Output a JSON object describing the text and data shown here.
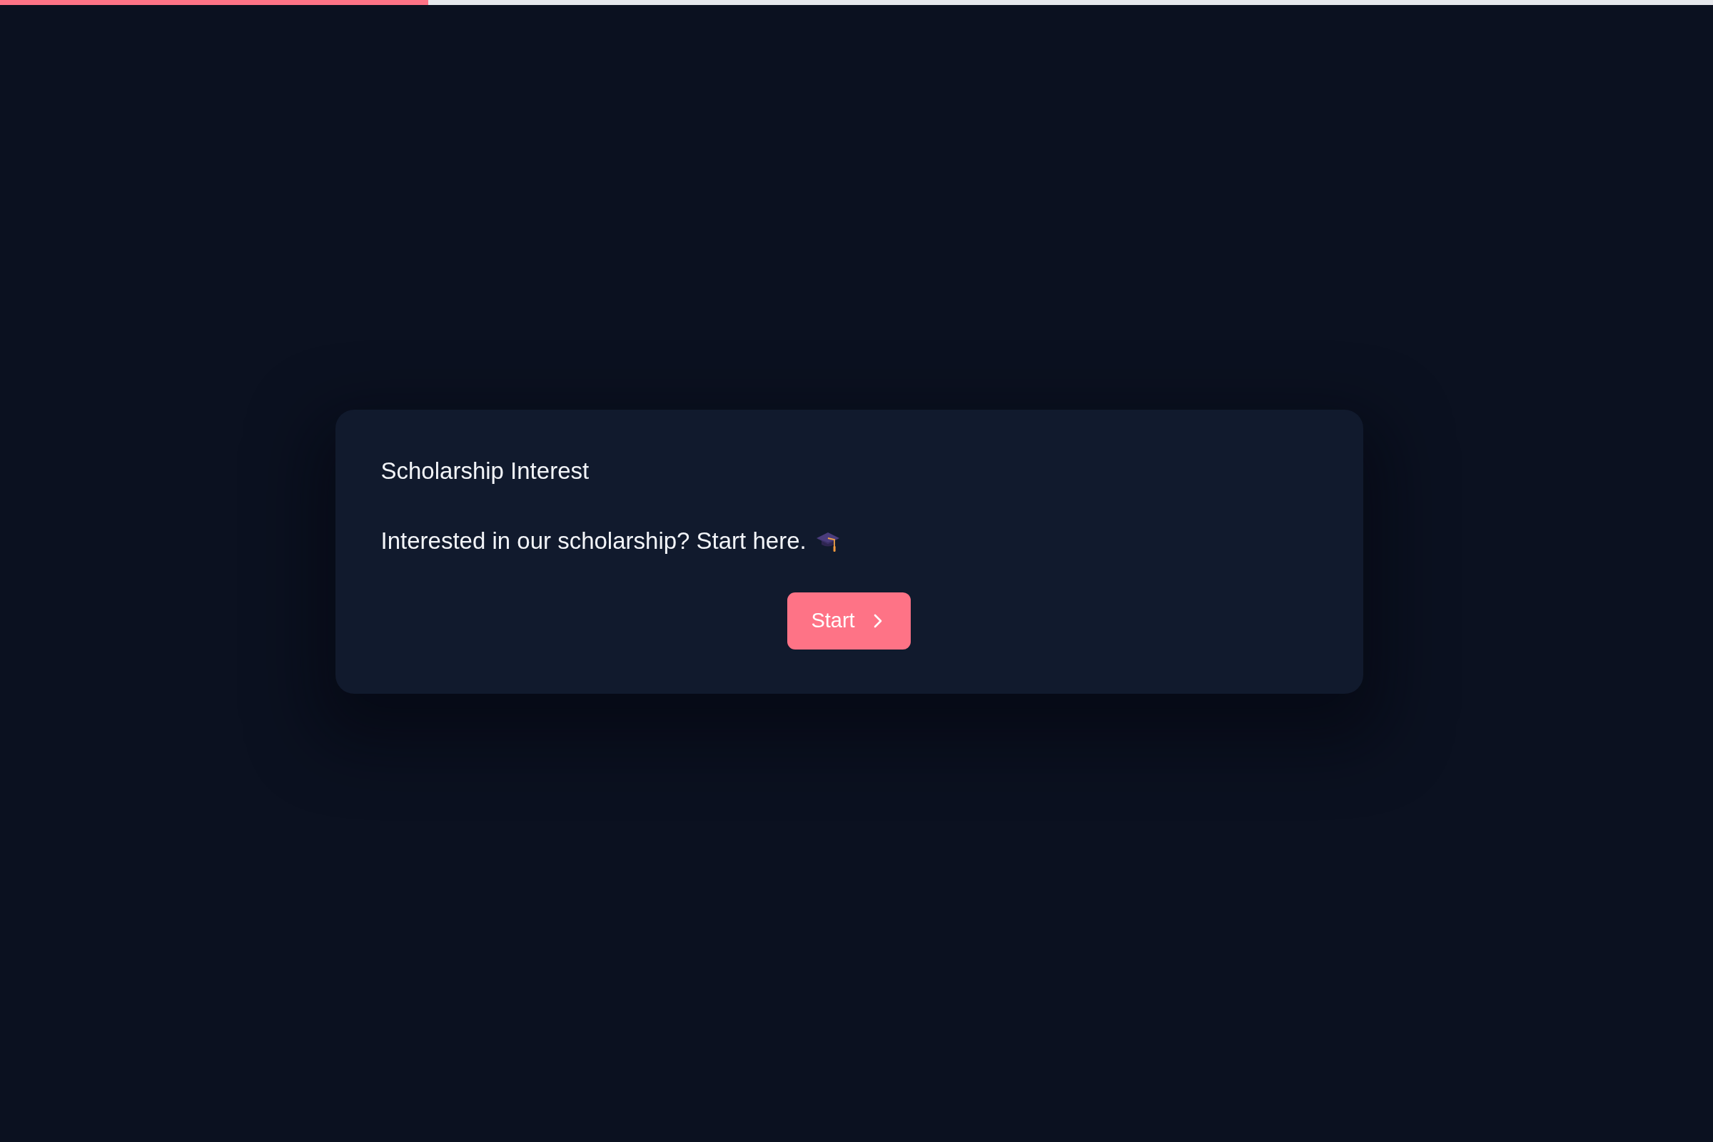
{
  "progress": {
    "level": 0.25
  },
  "card": {
    "title": "Scholarship Interest",
    "description": "Interested in our scholarship? Start here.",
    "button": {
      "label": "Start"
    }
  }
}
